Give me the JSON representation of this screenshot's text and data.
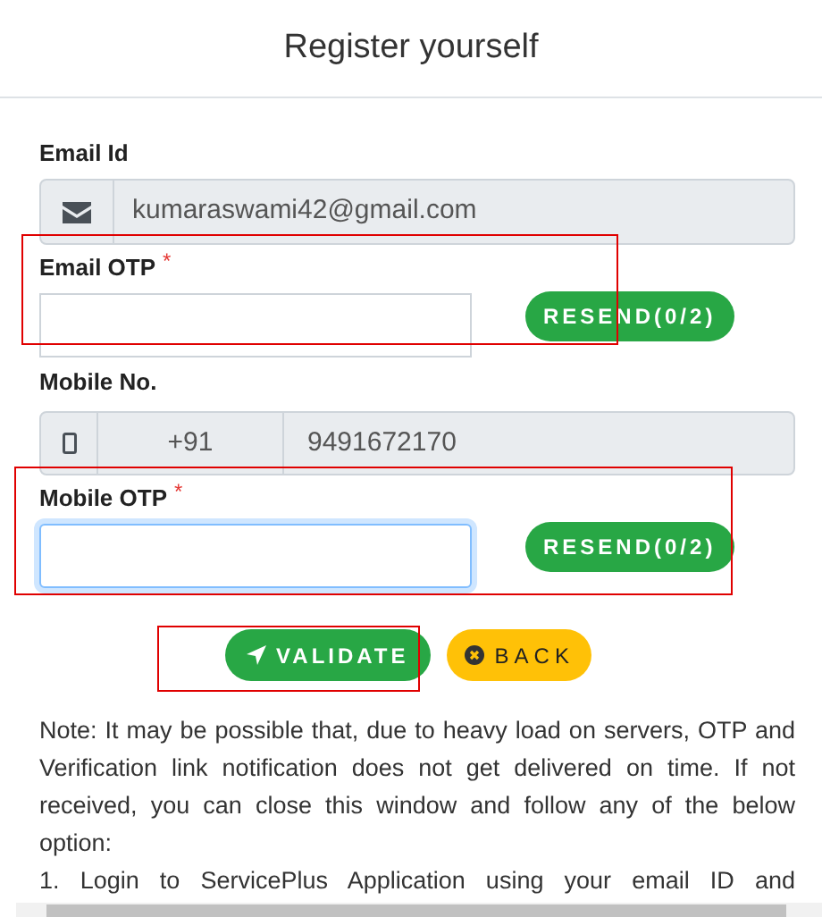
{
  "title": "Register yourself",
  "email": {
    "label": "Email Id",
    "value": "kumaraswami42@gmail.com"
  },
  "email_otp": {
    "label": "Email OTP",
    "required_mark": "*",
    "focused": false,
    "highlighted": true,
    "resend": "RESEND(0/2)"
  },
  "mobile": {
    "label": "Mobile No.",
    "code": "+91",
    "value": "9491672170"
  },
  "mobile_otp": {
    "label": "Mobile OTP",
    "required_mark": "*",
    "focused": true,
    "highlighted": true,
    "resend": "RESEND(0/2)"
  },
  "validate": {
    "label": "VALIDATE",
    "highlighted": true
  },
  "back": {
    "label": "BACK"
  },
  "note": [
    "Note: It may be possible that, due to heavy load on servers, OTP and Verification link notification does not get delivered on time. If not received, you can close this window and follow any of the below option:",
    "1. Login to ServicePlus Application using your email ID and"
  ]
}
